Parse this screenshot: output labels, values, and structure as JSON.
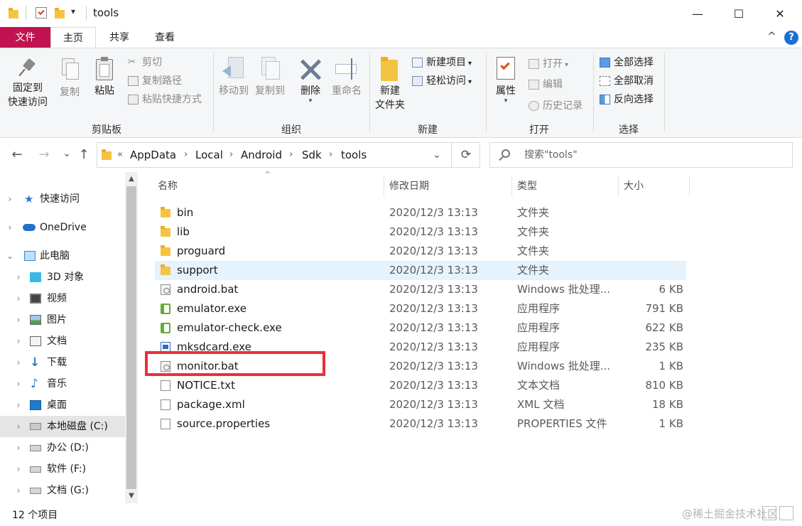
{
  "window": {
    "title": "tools",
    "minimize": "—",
    "maximize": "☐",
    "close": "✕"
  },
  "quick_access_dropdown": "▾",
  "ribbon_tabs": {
    "file": "文件",
    "home": "主页",
    "share": "共享",
    "view": "查看",
    "collapse": "^",
    "help": "?"
  },
  "ribbon": {
    "clipboard": {
      "label": "剪贴板",
      "pin_line1": "固定到",
      "pin_line2": "快速访问",
      "copy": "复制",
      "paste": "粘贴",
      "cut": "剪切",
      "copy_path": "复制路径",
      "paste_shortcut": "粘贴快捷方式"
    },
    "organize": {
      "label": "组织",
      "move_to": "移动到",
      "copy_to": "复制到",
      "delete": "删除",
      "rename": "重命名"
    },
    "new": {
      "label": "新建",
      "new_folder_line1": "新建",
      "new_folder_line2": "文件夹",
      "new_item": "新建项目",
      "easy_access": "轻松访问"
    },
    "open": {
      "label": "打开",
      "properties": "属性",
      "open": "打开",
      "edit": "编辑",
      "history": "历史记录"
    },
    "select": {
      "label": "选择",
      "select_all": "全部选择",
      "select_none": "全部取消",
      "invert": "反向选择"
    }
  },
  "address_bar": {
    "back": "←",
    "forward": "→",
    "recent": "⌄",
    "up": "↑",
    "overflow": "«",
    "crumbs": [
      "AppData",
      "Local",
      "Android",
      "Sdk",
      "tools"
    ],
    "separator": "›",
    "dropdown": "⌄",
    "refresh": "⟳"
  },
  "search": {
    "placeholder": "搜索\"tools\""
  },
  "nav_tree": [
    {
      "label": "快速访问",
      "icon": "star-icon"
    },
    {
      "label": "OneDrive",
      "icon": "cloud-icon"
    },
    {
      "label": "此电脑",
      "icon": "computer-icon"
    },
    {
      "label": "3D 对象",
      "icon": "cube-icon"
    },
    {
      "label": "视频",
      "icon": "film-icon"
    },
    {
      "label": "图片",
      "icon": "picture-icon"
    },
    {
      "label": "文档",
      "icon": "document-icon"
    },
    {
      "label": "下载",
      "icon": "download-icon"
    },
    {
      "label": "音乐",
      "icon": "music-icon"
    },
    {
      "label": "桌面",
      "icon": "desktop-icon"
    },
    {
      "label": "本地磁盘 (C:)",
      "icon": "drive-icon"
    },
    {
      "label": "办公 (D:)",
      "icon": "drive-icon"
    },
    {
      "label": "软件 (F:)",
      "icon": "drive-icon"
    },
    {
      "label": "文档 (G:)",
      "icon": "drive-icon"
    }
  ],
  "columns": {
    "name": "名称",
    "date": "修改日期",
    "type": "类型",
    "size": "大小",
    "sort_indicator": "^"
  },
  "files": [
    {
      "name": "bin",
      "date": "2020/12/3 13:13",
      "type": "文件夹",
      "size": "",
      "icon": "folder-icon"
    },
    {
      "name": "lib",
      "date": "2020/12/3 13:13",
      "type": "文件夹",
      "size": "",
      "icon": "folder-icon"
    },
    {
      "name": "proguard",
      "date": "2020/12/3 13:13",
      "type": "文件夹",
      "size": "",
      "icon": "folder-icon"
    },
    {
      "name": "support",
      "date": "2020/12/3 13:13",
      "type": "文件夹",
      "size": "",
      "icon": "folder-icon"
    },
    {
      "name": "android.bat",
      "date": "2020/12/3 13:13",
      "type": "Windows 批处理...",
      "size": "6 KB",
      "icon": "batch-file-icon"
    },
    {
      "name": "emulator.exe",
      "date": "2020/12/3 13:13",
      "type": "应用程序",
      "size": "791 KB",
      "icon": "exe-icon"
    },
    {
      "name": "emulator-check.exe",
      "date": "2020/12/3 13:13",
      "type": "应用程序",
      "size": "622 KB",
      "icon": "exe-icon"
    },
    {
      "name": "mksdcard.exe",
      "date": "2020/12/3 13:13",
      "type": "应用程序",
      "size": "235 KB",
      "icon": "exe-window-icon"
    },
    {
      "name": "monitor.bat",
      "date": "2020/12/3 13:13",
      "type": "Windows 批处理...",
      "size": "1 KB",
      "icon": "batch-file-icon"
    },
    {
      "name": "NOTICE.txt",
      "date": "2020/12/3 13:13",
      "type": "文本文档",
      "size": "810 KB",
      "icon": "text-file-icon"
    },
    {
      "name": "package.xml",
      "date": "2020/12/3 13:13",
      "type": "XML 文档",
      "size": "18 KB",
      "icon": "file-icon"
    },
    {
      "name": "source.properties",
      "date": "2020/12/3 13:13",
      "type": "PROPERTIES 文件",
      "size": "1 KB",
      "icon": "file-icon"
    }
  ],
  "status": {
    "count": "12 个项目"
  },
  "watermark": "@稀土掘金技术社区",
  "colors": {
    "file_tab": "#c0134f",
    "highlight": "#e8303a",
    "hover_row": "#e5f3ff",
    "help": "#1a6fd1"
  }
}
